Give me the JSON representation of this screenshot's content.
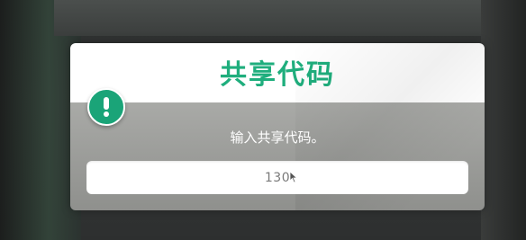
{
  "dialog": {
    "title": "共享代码",
    "message": "输入共享代码。",
    "input": {
      "value": "130"
    },
    "alert_icon": "exclamation-icon"
  },
  "colors": {
    "accent": "#1fae7d",
    "badge": "#1aa478",
    "body_gray": "#a2a3a0"
  },
  "cursor_icon": "mouse-pointer-icon"
}
